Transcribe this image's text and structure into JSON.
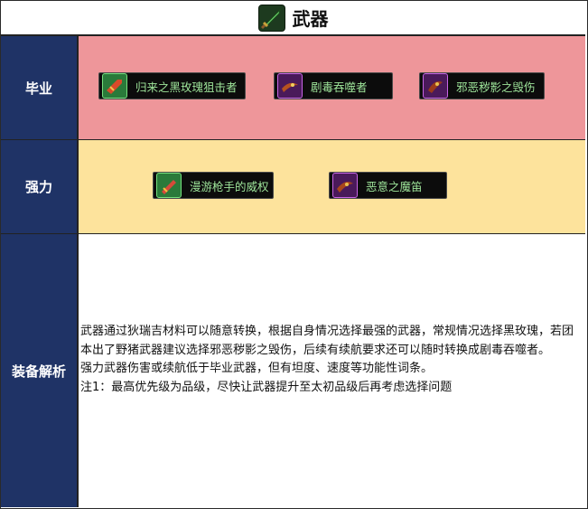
{
  "header": {
    "title": "武器",
    "icon": "green-dagger-icon"
  },
  "rows": [
    {
      "label": "毕业",
      "color": "#ee969a",
      "items": [
        {
          "name": "归来之黑玫瑰狙击者",
          "icon": "rifle-icon",
          "frame": "green"
        },
        {
          "name": "剧毒吞噬者",
          "icon": "claw-weapon-icon",
          "frame": "purple"
        },
        {
          "name": "邪恶秽影之毁伤",
          "icon": "claw-weapon-icon",
          "frame": "purple"
        }
      ]
    },
    {
      "label": "强力",
      "color": "#fde39c",
      "items": [
        {
          "name": "漫游枪手的威权",
          "icon": "gun-icon",
          "frame": "green"
        },
        {
          "name": "恶意之魔笛",
          "icon": "claw-weapon-icon",
          "frame": "purple"
        }
      ]
    }
  ],
  "analysis": {
    "label": "装备解析",
    "paragraphs": [
      "武器通过狄瑞吉材料可以随意转换，根据自身情况选择最强的武器，常规情况选择黑玫瑰，若团本出了野猪武器建议选择邪恶秽影之毁伤，后续有续航要求还可以随时转换成剧毒吞噬者。",
      "强力武器伤害或续航低于毕业武器，但有坦度、速度等功能性词条。",
      "注1：最高优先级为品级，尽快让武器提升至太初品级后再考虑选择问题"
    ]
  }
}
